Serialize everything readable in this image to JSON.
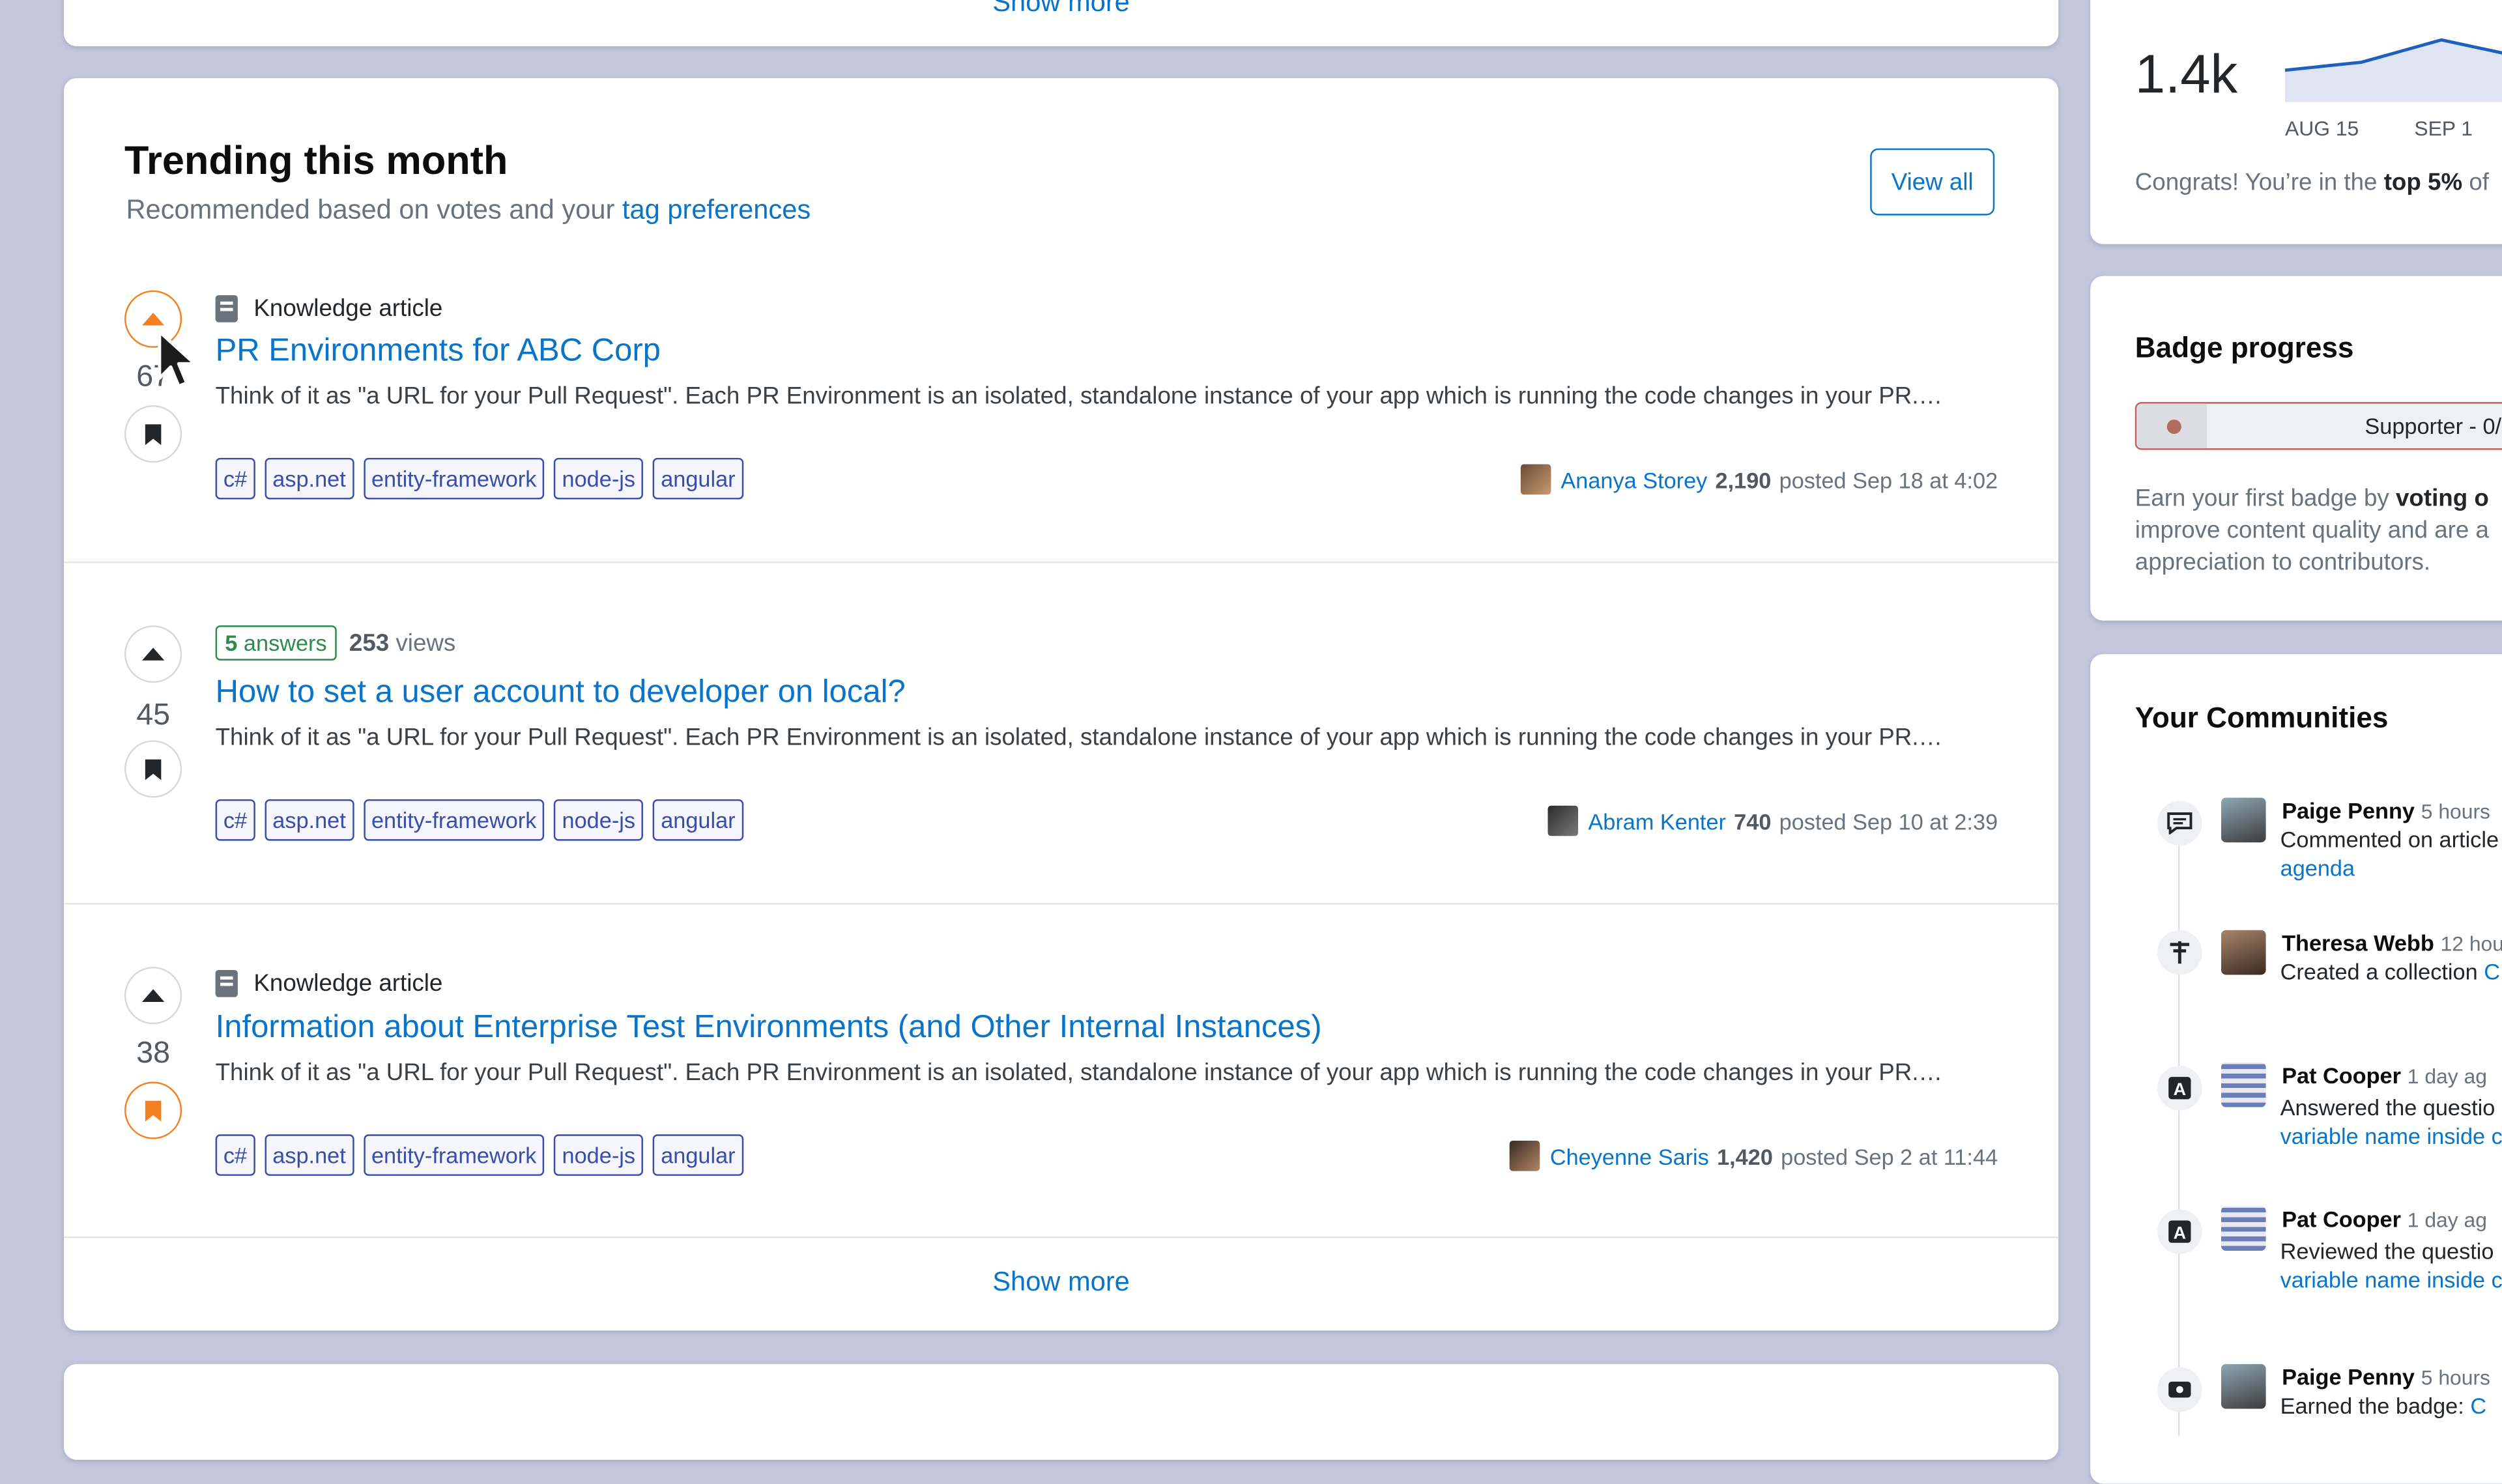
{
  "top_card": {
    "show_more": "Show more"
  },
  "trending": {
    "title": "Trending this month",
    "subtitle_prefix": "Recommended based on votes and your ",
    "subtitle_link": "tag preferences",
    "view_all": "View all",
    "show_more": "Show more",
    "posts": [
      {
        "kind": "Knowledge article",
        "votes": "67",
        "title": "PR Environments for ABC Corp",
        "excerpt": "Think of it as \"a URL for your Pull Request\". Each PR Environment is an isolated, standalone instance of your app which is running the code changes in your PR.…",
        "tags": [
          "c#",
          "asp.net",
          "entity-framework",
          "node-js",
          "angular"
        ],
        "author": "Ananya Storey",
        "rep": "2,190",
        "posted": "posted Sep 18 at 4:02",
        "upvoted": true,
        "saved": false
      },
      {
        "answers_count": "5",
        "answers_label": "answers",
        "views_count": "253",
        "views_label": "views",
        "votes": "45",
        "title": "How to set a user account to developer on local?",
        "excerpt": "Think of it as \"a URL for your Pull Request\". Each PR Environment is an isolated, standalone instance of your app which is running the code changes in your PR.…",
        "tags": [
          "c#",
          "asp.net",
          "entity-framework",
          "node-js",
          "angular"
        ],
        "author": "Abram Kenter",
        "rep": "740",
        "posted": "posted Sep 10 at 2:39",
        "upvoted": false,
        "saved": false
      },
      {
        "kind": "Knowledge article",
        "votes": "38",
        "title": "Information about Enterprise Test Environments (and Other Internal Instances)",
        "excerpt": "Think of it as \"a URL for your Pull Request\". Each PR Environment is an isolated, standalone instance of your app which is running the code changes in your PR.…",
        "tags": [
          "c#",
          "asp.net",
          "entity-framework",
          "node-js",
          "angular"
        ],
        "author": "Cheyenne Saris",
        "rep": "1,420",
        "posted": "posted Sep 2 at 11:44",
        "upvoted": false,
        "saved": true
      }
    ]
  },
  "stats": {
    "value": "1.4k",
    "label_aug": "AUG 15",
    "label_sep": "SEP 1",
    "congrats_prefix": "Congrats! You’re in the ",
    "congrats_bold": "top 5%",
    "congrats_suffix": " of"
  },
  "badge": {
    "title": "Badge progress",
    "bar_label": "Supporter - 0/",
    "progress": 0,
    "desc_line1_prefix": "Earn your first badge by ",
    "desc_line1_bold": "voting o",
    "desc_line2": "improve content quality and are a",
    "desc_line3": "appreciation to contributors."
  },
  "communities": {
    "title": "Your Communities",
    "activities": [
      {
        "icon": "comment-icon",
        "name": "Paige Penny",
        "time": "5 hours",
        "text": "Commented on article",
        "link": "agenda"
      },
      {
        "icon": "collection-icon",
        "name": "Theresa Webb",
        "time": "12 hou",
        "text": "Created a collection ",
        "text_link": "C"
      },
      {
        "icon": "answer-icon",
        "name": "Pat Cooper",
        "time": "1 day ag",
        "text": "Answered the questio",
        "link": "variable name inside c"
      },
      {
        "icon": "answer-icon",
        "name": "Pat Cooper",
        "time": "1 day ag",
        "text": "Reviewed the questio",
        "link": "variable name inside c"
      },
      {
        "icon": "badge-icon",
        "name": "Paige Penny",
        "time": "5 hours",
        "text": "Earned the badge: ",
        "text_link": "C"
      }
    ]
  },
  "colors": {
    "accent": "#0a74c9",
    "vote_active": "#f48024",
    "answered": "#2f8b4c",
    "tag": "#3b4da8",
    "background": "#c5c7de"
  }
}
